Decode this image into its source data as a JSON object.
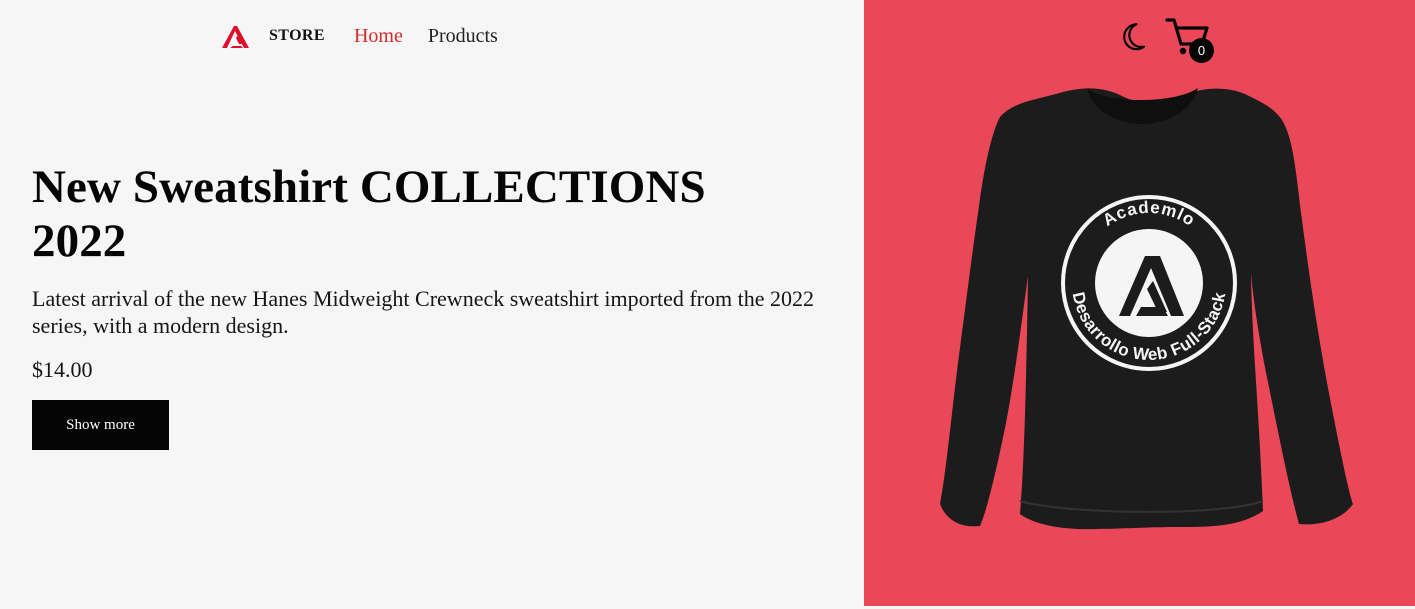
{
  "brand": {
    "name": "STORE"
  },
  "nav": {
    "items": [
      {
        "label": "Home",
        "active": true
      },
      {
        "label": "Products",
        "active": false
      }
    ]
  },
  "hero": {
    "title_line1": "New Sweatshirt COLLECTIONS",
    "title_line2": "2022",
    "description": "Latest arrival of the new Hanes Midweight Crewneck sweatshirt imported from the 2022 series, with a modern design.",
    "price": "$14.00",
    "button_label": "Show more"
  },
  "header_actions": {
    "theme_icon": "moon-icon",
    "cart_icon": "cart-icon",
    "cart_count": "0"
  },
  "product_image": {
    "badge_top": "Academlo",
    "badge_bottom": "Desarrollo Web Full-Stack"
  },
  "colors": {
    "accent": "#d62a2a",
    "hero_panel": "#ea4858",
    "page_background": "#f6f6f6",
    "button_background": "#050505",
    "text": "#111111"
  }
}
